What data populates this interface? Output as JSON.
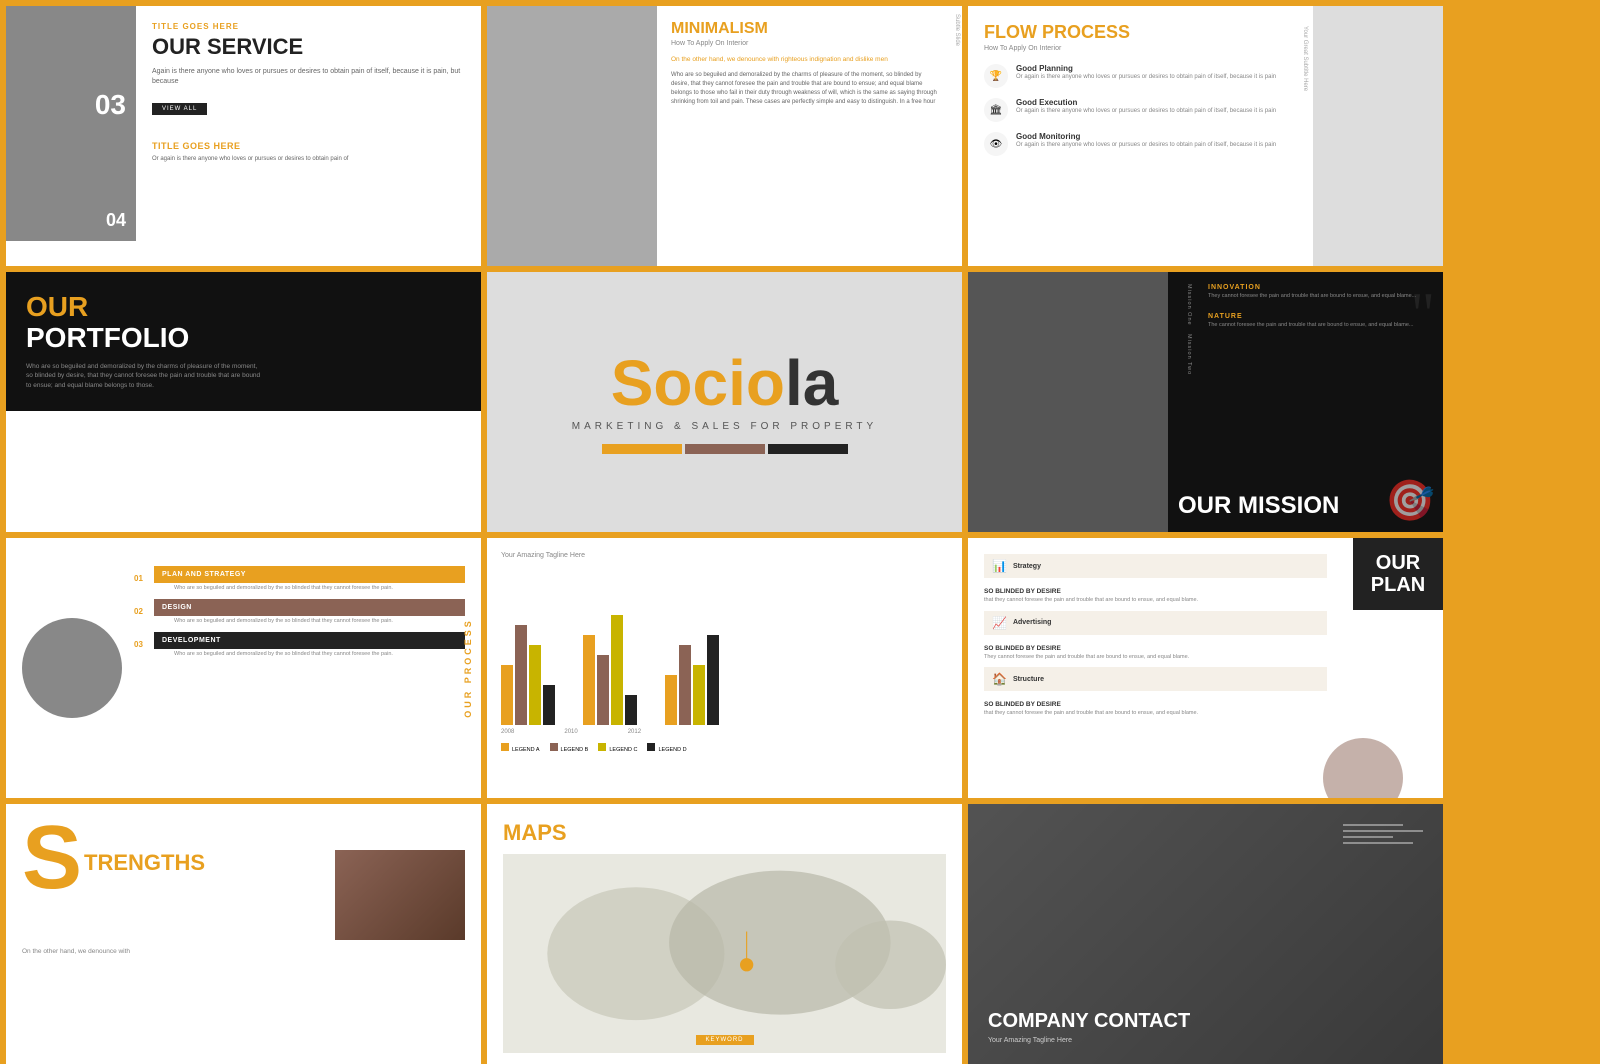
{
  "slides": {
    "service": {
      "title": "OUR SERVICE",
      "item1_num": "03",
      "item1_title": "TITLE GOES HERE",
      "item1_desc": "Or again is there anyone who loves or pursues or desires to obtain pain of itself, because it is pain, but because",
      "item2_num": "04",
      "item2_title": "TITLE GOES HERE",
      "item2_desc": "Or again is there anyone who loves or pursues or desires to obtain pain of",
      "view_all": "VIEW ALL",
      "body_text": "Again is there anyone who loves or pursues or desires to obtain pain of itself, because it is pain, but because"
    },
    "minimalism": {
      "title": "MINIMALISM",
      "subtitle": "How To Apply On Interior",
      "orange_text": "On the other hand, we denounce with righteous indignation and dislike men",
      "body_text": "Who are so beguiled and demoralized by the charms of pleasure of the moment, so blinded by desire, that they cannot foresee the pain and trouble that are bound to ensue; and equal blame belongs to those who fail in their duty through weakness of will, which is the same as saying through shrinking from toil and pain. These cases are perfectly simple and easy to distinguish. In a free hour"
    },
    "flow": {
      "title": "FLOW PROCESS",
      "subtitle": "How To Apply On Interior",
      "items": [
        {
          "icon": "🏆",
          "title": "Good Planning",
          "desc": "Or again is there anyone who loves or pursues or desires to obtain pain of itself, because it is pain"
        },
        {
          "icon": "🏛",
          "title": "Good Execution",
          "desc": "Or again is there anyone who loves or pursues or desires to obtain pain of itself, because it is pain"
        },
        {
          "icon": "👁",
          "title": "Good Monitoring",
          "desc": "Or again is there anyone who loves or pursues or desires to obtain pain of itself, because it is pain"
        }
      ]
    },
    "portfolio": {
      "title_line1": "OUR",
      "title_line2": "PORTFOLIO",
      "body_text": "Who are so beguiled and demoralized by the charms of pleasure of the moment, so blinded by desire, that they cannot foresee the pain and trouble that are bound to ensue; and equal blame belongs to those."
    },
    "logo": {
      "name_orange": "Socio",
      "name_dark": "la",
      "tagline": "MARKETING & SALES FOR PROPERTY"
    },
    "mission": {
      "title": "OUR MISSION",
      "items": [
        {
          "label": "Mission One",
          "title": "INNOVATION",
          "desc": "They cannot foresee the pain and trouble that are bound to ensue, and equal blame..."
        },
        {
          "label": "Mission Two",
          "title": "NATURE",
          "desc": "The cannot foresee the pain and trouble that are bound to ensue, and equal blame..."
        }
      ]
    },
    "process": {
      "steps": [
        {
          "num": "01",
          "label": "PLAN AND STRATEGY",
          "color": "orange",
          "desc": "Who are so beguiled and demoralized by the so blinded that they cannot foresee the pain."
        },
        {
          "num": "02",
          "label": "DESIGN",
          "color": "brown",
          "desc": "Who are so beguiled and demoralized by the so blinded that they cannot foresee the pain."
        },
        {
          "num": "03",
          "label": "DEVELOPMENT",
          "color": "dark",
          "desc": "Who are so beguiled and demoralized by the so blinded that they cannot foresee the pain."
        }
      ],
      "side_label": "OUR PROCESS"
    },
    "chart": {
      "tagline": "Your Amazing Tagline Here",
      "years": [
        "2008",
        "2010",
        "2012"
      ],
      "legend": [
        "LEGEND A",
        "LEGEND B",
        "LEGEND C",
        "LEGEND D"
      ],
      "legend_colors": [
        "#e8a020",
        "#8B6355",
        "#c8b400",
        "#222"
      ],
      "bars": [
        [
          60,
          100,
          80,
          40
        ],
        [
          90,
          70,
          110,
          30
        ],
        [
          50,
          80,
          60,
          90
        ]
      ]
    },
    "ourplan": {
      "title": "OUR PLAN",
      "items": [
        {
          "icon": "📊",
          "title": "Strategy",
          "title_label": "SO BLINDED BY DESIRE",
          "desc": "that they cannot foresee the pain and trouble that are bound to ensue, and equal blame."
        },
        {
          "icon": "📈",
          "title": "Advertising",
          "title_label": "SO BLINDED BY DESIRE",
          "desc": "They cannot foresee the pain and trouble that are bound to ensue, and equal blame."
        },
        {
          "icon": "🏠",
          "title": "Structure",
          "title_label": "SO BLINDED BY DESIRE",
          "desc": "that they cannot foresee the pain and trouble that are bound to ensue, and equal blame."
        }
      ]
    },
    "strengths": {
      "big_letter": "S",
      "title": "TRENGTHS",
      "body_text": "On the other hand, we denounce with"
    },
    "maps": {
      "title": "MAPS",
      "keyword": "KEYWORD"
    },
    "contact": {
      "title": "COMPANY CONTACT",
      "tagline": "Your Amazing Tagline Here"
    }
  },
  "colors": {
    "orange": "#e8a020",
    "dark": "#222222",
    "brown": "#8B6355",
    "light_bg": "#f5f0e8"
  }
}
